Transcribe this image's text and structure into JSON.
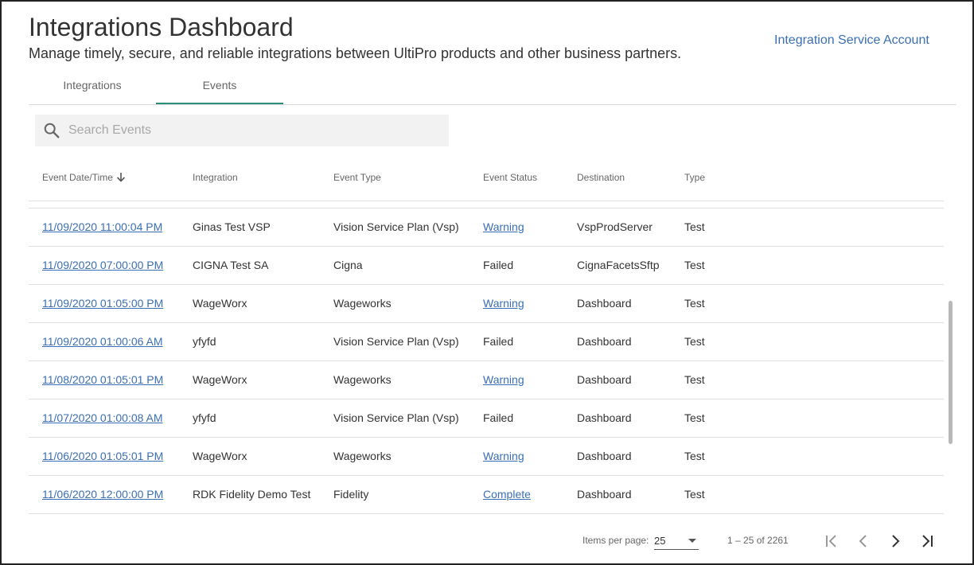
{
  "header": {
    "title": "Integrations Dashboard",
    "subtitle": "Manage timely, secure, and reliable integrations between UltiPro products and other business partners.",
    "account_link": "Integration Service Account"
  },
  "tabs": [
    {
      "label": "Integrations",
      "active": false
    },
    {
      "label": "Events",
      "active": true
    }
  ],
  "search": {
    "placeholder": "Search Events",
    "value": ""
  },
  "table": {
    "columns": [
      "Event Date/Time",
      "Integration",
      "Event Type",
      "Event Status",
      "Destination",
      "Type"
    ],
    "sort": {
      "column": "Event Date/Time",
      "direction": "desc"
    },
    "rows": [
      {
        "datetime": "11/09/2020 11:00:04 PM",
        "integration": "Ginas Test VSP",
        "event_type": "Vision Service Plan (Vsp)",
        "status": "Warning",
        "destination": "VspProdServer",
        "type": "Test"
      },
      {
        "datetime": "11/09/2020 07:00:00 PM",
        "integration": "CIGNA Test SA",
        "event_type": "Cigna",
        "status": "Failed",
        "destination": "CignaFacetsSftp",
        "type": "Test"
      },
      {
        "datetime": "11/09/2020 01:05:00 PM",
        "integration": "WageWorx",
        "event_type": "Wageworks",
        "status": "Warning",
        "destination": "Dashboard",
        "type": "Test"
      },
      {
        "datetime": "11/09/2020 01:00:06 AM",
        "integration": "yfyfd",
        "event_type": "Vision Service Plan (Vsp)",
        "status": "Failed",
        "destination": "Dashboard",
        "type": "Test"
      },
      {
        "datetime": "11/08/2020 01:05:01 PM",
        "integration": "WageWorx",
        "event_type": "Wageworks",
        "status": "Warning",
        "destination": "Dashboard",
        "type": "Test"
      },
      {
        "datetime": "11/07/2020 01:00:08 AM",
        "integration": "yfyfd",
        "event_type": "Vision Service Plan (Vsp)",
        "status": "Failed",
        "destination": "Dashboard",
        "type": "Test"
      },
      {
        "datetime": "11/06/2020 01:05:01 PM",
        "integration": "WageWorx",
        "event_type": "Wageworks",
        "status": "Warning",
        "destination": "Dashboard",
        "type": "Test"
      },
      {
        "datetime": "11/06/2020 12:00:00 PM",
        "integration": "RDK Fidelity Demo Test",
        "event_type": "Fidelity",
        "status": "Complete",
        "destination": "Dashboard",
        "type": "Test"
      }
    ]
  },
  "pagination": {
    "items_per_page_label": "Items per page:",
    "items_per_page": "25",
    "range": "1 – 25 of 2261"
  },
  "colors": {
    "link": "#3b6fb6",
    "tab_active": "#2e8b7a"
  },
  "icons": {
    "search": "search-icon",
    "sort": "arrow-down-icon",
    "dropdown": "caret-down-icon",
    "first": "first-page-icon",
    "prev": "chevron-left-icon",
    "next": "chevron-right-icon",
    "last": "last-page-icon"
  }
}
